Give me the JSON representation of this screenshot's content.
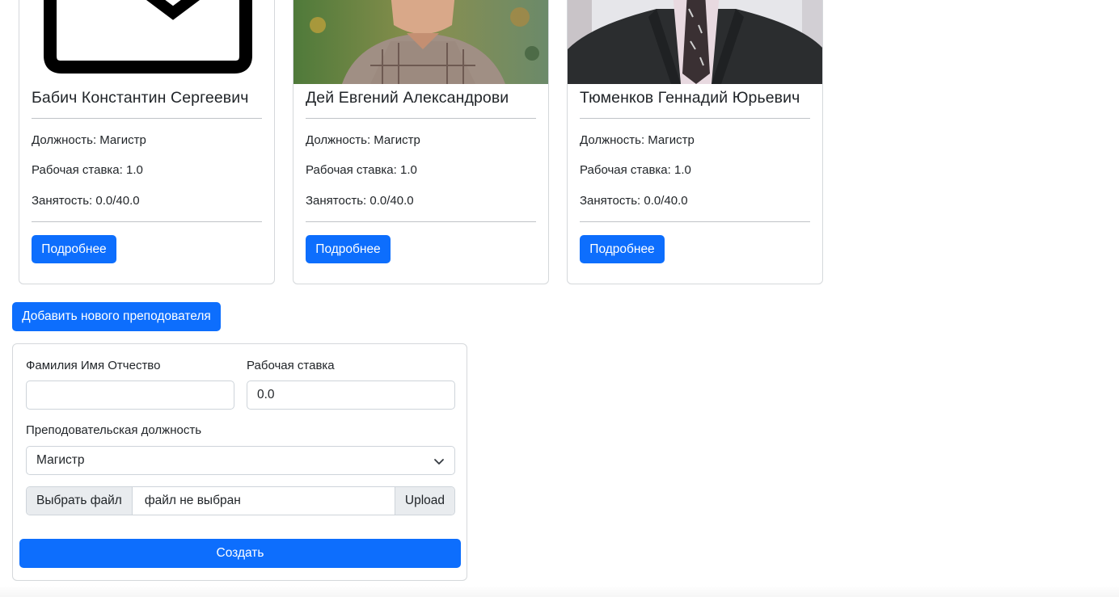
{
  "teachers": [
    {
      "name": "Бабич Константин Сергеевич",
      "position": "Должность: Магистр",
      "rate": "Рабочая ставка: 1.0",
      "load": "Занятость: 0.0/40.0",
      "details_label": "Подробнее",
      "photo_icon": "envelope-icon"
    },
    {
      "name": "Дей Евгений Александрови",
      "position": "Должность: Магистр",
      "rate": "Рабочая ставка: 1.0",
      "load": "Занятость: 0.0/40.0",
      "details_label": "Подробнее",
      "photo_icon": "person-photo"
    },
    {
      "name": "Тюменков Геннадий Юрьевич",
      "position": "Должность: Магистр",
      "rate": "Рабочая ставка: 1.0",
      "load": "Занятость: 0.0/40.0",
      "details_label": "Подробнее",
      "photo_icon": "person-photo"
    }
  ],
  "add_teacher_label": "Добавить нового преподователя",
  "form": {
    "fio_label": "Фамилия Имя Отчество",
    "fio_value": "",
    "rate_label": "Рабочая ставка",
    "rate_value": "0.0",
    "position_label": "Преподовательская должность",
    "position_selected": "Магистр",
    "file_button_label": "Выбрать файл",
    "file_status": "файл не выбран",
    "upload_label": "Upload",
    "submit_label": "Создать"
  },
  "colors": {
    "primary": "#0d6efd",
    "border": "#d5d8db",
    "text": "#212529"
  }
}
